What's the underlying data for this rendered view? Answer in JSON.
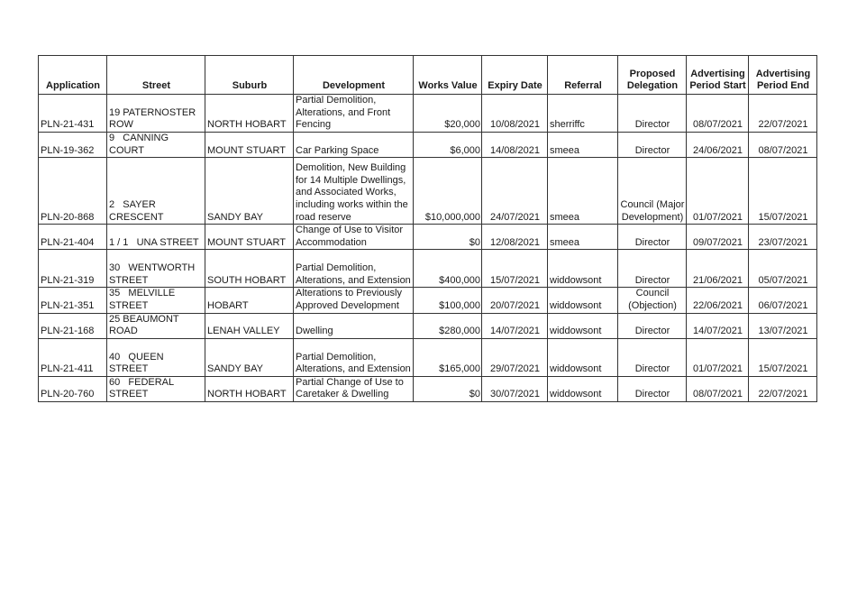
{
  "table": {
    "headers": [
      "Application",
      "Street",
      "Suburb",
      "Development",
      "Works Value",
      "Expiry Date",
      "Referral",
      "Proposed Delegation",
      "Advertising Period Start",
      "Advertising Period End"
    ],
    "rows": [
      {
        "application": "PLN-21-431",
        "street": "19 PATERNOSTER ROW",
        "suburb": "NORTH HOBART",
        "development": "Partial Demolition, Alterations, and Front Fencing",
        "works_value": "$20,000",
        "expiry_date": "10/08/2021",
        "referral": "sherriffc",
        "delegation": "Director",
        "ad_start": "08/07/2021",
        "ad_end": "22/07/2021"
      },
      {
        "application": "PLN-19-362",
        "street": "9   CANNING COURT",
        "suburb": "MOUNT STUART",
        "development": "Car Parking Space",
        "works_value": "$6,000",
        "expiry_date": "14/08/2021",
        "referral": "smeea",
        "delegation": "Director",
        "ad_start": "24/06/2021",
        "ad_end": "08/07/2021"
      },
      {
        "application": "PLN-20-868",
        "street": "2   SAYER CRESCENT",
        "suburb": "SANDY BAY",
        "development": "Demolition, New Building for 14 Multiple Dwellings, and Associated Works, including works within the road reserve",
        "works_value": "$10,000,000",
        "expiry_date": "24/07/2021",
        "referral": "smeea",
        "delegation": "Council (Major Development)",
        "ad_start": "01/07/2021",
        "ad_end": "15/07/2021"
      },
      {
        "application": "PLN-21-404",
        "street": "1 / 1   UNA STREET",
        "suburb": "MOUNT STUART",
        "development": "Change of Use to Visitor Accommodation",
        "works_value": "$0",
        "expiry_date": "12/08/2021",
        "referral": "smeea",
        "delegation": "Director",
        "ad_start": "09/07/2021",
        "ad_end": "23/07/2021"
      },
      {
        "application": "PLN-21-319",
        "street": "30   WENTWORTH STREET",
        "suburb": "SOUTH HOBART",
        "development": "Partial Demolition, Alterations, and Extension",
        "works_value": "$400,000",
        "expiry_date": "15/07/2021",
        "referral": "widdowsont",
        "delegation": "Director",
        "ad_start": "21/06/2021",
        "ad_end": "05/07/2021"
      },
      {
        "application": "PLN-21-351",
        "street": "35   MELVILLE STREET",
        "suburb": "HOBART",
        "development": "Alterations to Previously Approved Development",
        "works_value": "$100,000",
        "expiry_date": "20/07/2021",
        "referral": "widdowsont",
        "delegation": "Council (Objection)",
        "ad_start": "22/06/2021",
        "ad_end": "06/07/2021"
      },
      {
        "application": "PLN-21-168",
        "street": "25 BEAUMONT ROAD",
        "suburb": "LENAH VALLEY",
        "development": "Dwelling",
        "works_value": "$280,000",
        "expiry_date": "14/07/2021",
        "referral": "widdowsont",
        "delegation": "Director",
        "ad_start": "14/07/2021",
        "ad_end": "13/07/2021"
      },
      {
        "application": "PLN-21-411",
        "street": "40   QUEEN STREET",
        "suburb": "SANDY BAY",
        "development": "Partial Demolition, Alterations, and Extension",
        "works_value": "$165,000",
        "expiry_date": "29/07/2021",
        "referral": "widdowsont",
        "delegation": "Director",
        "ad_start": "01/07/2021",
        "ad_end": "15/07/2021"
      },
      {
        "application": "PLN-20-760",
        "street": "60   FEDERAL STREET",
        "suburb": "NORTH HOBART",
        "development": "Partial Change of Use to Caretaker & Dwelling",
        "works_value": "$0",
        "expiry_date": "30/07/2021",
        "referral": "widdowsont",
        "delegation": "Director",
        "ad_start": "08/07/2021",
        "ad_end": "22/07/2021"
      }
    ]
  }
}
